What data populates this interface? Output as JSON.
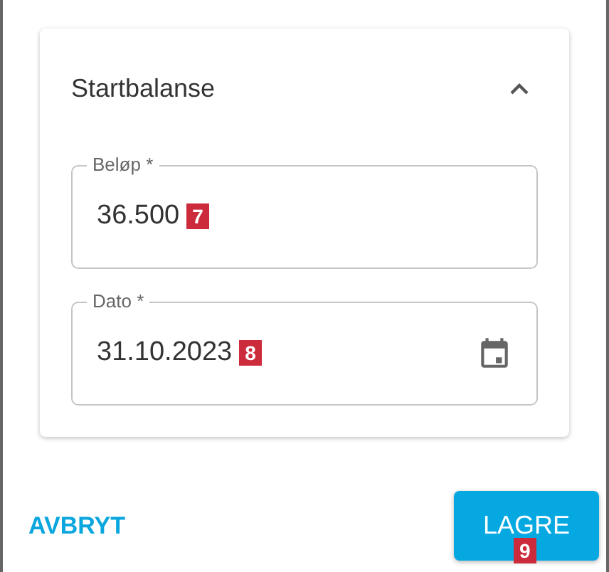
{
  "card": {
    "title": "Startbalanse",
    "expanded": true,
    "fields": [
      {
        "kind": "number",
        "label": "Beløp *",
        "value": "36.500",
        "marker": "7"
      },
      {
        "kind": "date",
        "label": "Dato *",
        "value": "31.10.2023",
        "marker": "8"
      }
    ]
  },
  "actions": {
    "cancel": "AVBRYT",
    "save": "LAGRE",
    "save_marker": "9"
  }
}
